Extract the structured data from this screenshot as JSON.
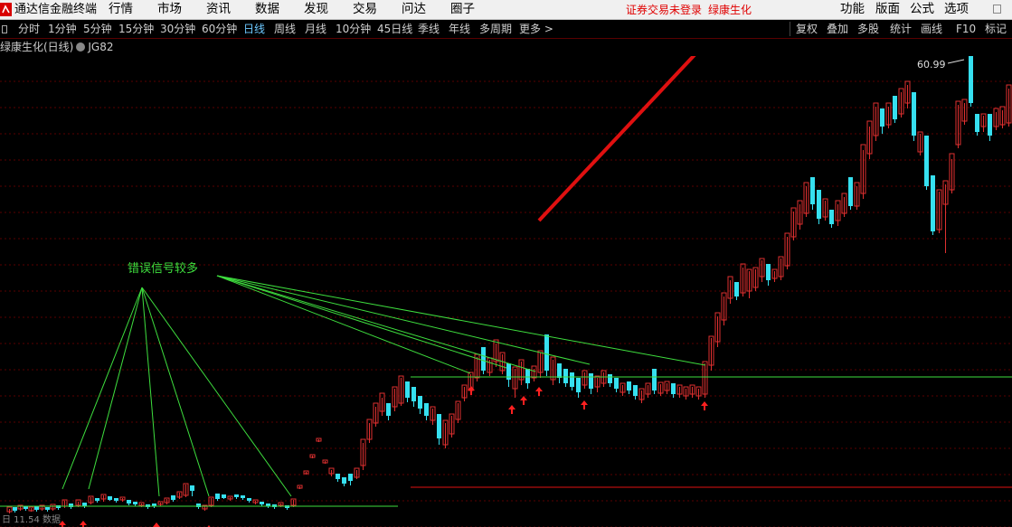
{
  "app": {
    "title": "通达信金融终端"
  },
  "menu": [
    "行情",
    "市场",
    "资讯",
    "数据",
    "发现",
    "交易",
    "问达",
    "圈子"
  ],
  "notice": {
    "login": "证券交易未登录",
    "stock": "绿康生化"
  },
  "right_menu": [
    "功能",
    "版面",
    "公式",
    "选项"
  ],
  "periods": [
    "分时",
    "1分钟",
    "5分钟",
    "15分钟",
    "30分钟",
    "60分钟",
    "日线",
    "周线",
    "月线",
    "10分钟",
    "45日线",
    "季线",
    "年线",
    "多周期",
    "更多 >"
  ],
  "active_period": "日线",
  "tools": [
    "复权",
    "叠加",
    "多股",
    "统计",
    "画线",
    "F10",
    "标记"
  ],
  "chart_title": {
    "stock": "绿康生化(日线)",
    "indicator": "JG82"
  },
  "annotation": {
    "text": "错误信号较多",
    "high_label": "60.99"
  },
  "footer": "日 11.54 数据",
  "colors": {
    "up": "#e03030",
    "down": "#36e0f0",
    "annot": "#3ede3e",
    "level": "#3ede3e",
    "red_line": "#e01010",
    "grid": "#5a0000"
  }
}
